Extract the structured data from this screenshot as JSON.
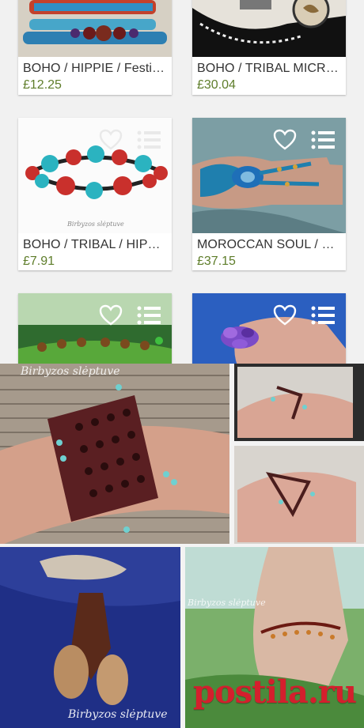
{
  "products": [
    {
      "title": "BOHO / HIPPIE / Festival",
      "price": "£12.25"
    },
    {
      "title": "BOHO / TRIBAL MICROMACRAME",
      "price": "£30.04"
    },
    {
      "title": "BOHO / TRIBAL / HIPPIE",
      "price": "£7.91"
    },
    {
      "title": "MOROCCAN SOUL / HIPPIE",
      "price": "£37.15"
    }
  ],
  "watermarks": {
    "signature_1": "Birbyzos slėptuve",
    "signature_2": "Birbyzos slėptuve",
    "signature_3": "Birbyzos slėptuve",
    "signature_4": "Birbyzos slėptuve"
  },
  "brand": {
    "text": "postila.ru"
  },
  "icons": {
    "favorite": "heart-outline-icon",
    "list": "list-icon"
  },
  "colors": {
    "price": "#5e7d2a",
    "brand": "#d41f2d",
    "title": "#333333",
    "background": "#f1f1f1"
  }
}
